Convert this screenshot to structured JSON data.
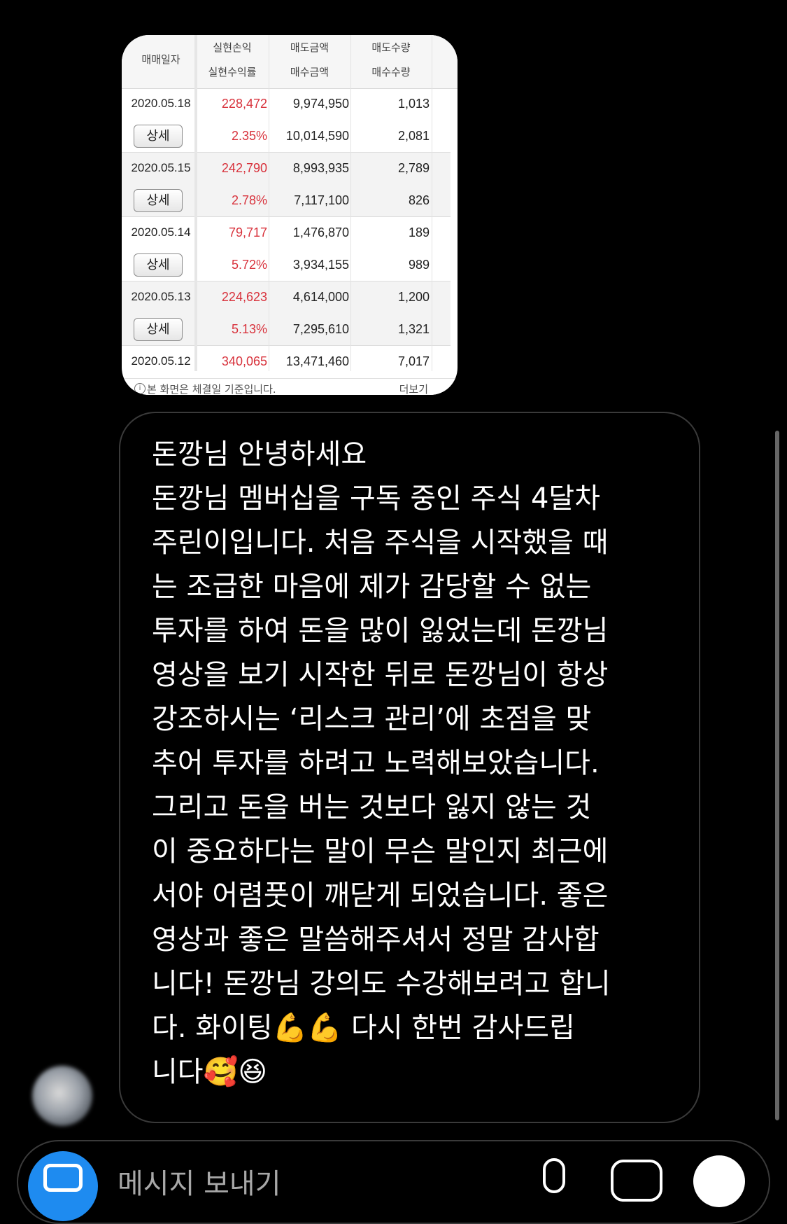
{
  "shared_image": {
    "headers": {
      "date": "매매일자",
      "col2_top": "실현손익",
      "col2_bottom": "실현수익률",
      "col3_top": "매도금액",
      "col3_bottom": "매수금액",
      "col4_top": "매도수량",
      "col4_bottom": "매수수량"
    },
    "detail_label": "상세",
    "rows": [
      {
        "date": "2020.05.18",
        "profit": "228,472",
        "rate": "2.35%",
        "sell_amount": "9,974,950",
        "buy_amount": "10,014,590",
        "sell_qty": "1,013",
        "buy_qty": "2,081"
      },
      {
        "date": "2020.05.15",
        "profit": "242,790",
        "rate": "2.78%",
        "sell_amount": "8,993,935",
        "buy_amount": "7,117,100",
        "sell_qty": "2,789",
        "buy_qty": "826"
      },
      {
        "date": "2020.05.14",
        "profit": "79,717",
        "rate": "5.72%",
        "sell_amount": "1,476,870",
        "buy_amount": "3,934,155",
        "sell_qty": "189",
        "buy_qty": "989"
      },
      {
        "date": "2020.05.13",
        "profit": "224,623",
        "rate": "5.13%",
        "sell_amount": "4,614,000",
        "buy_amount": "7,295,610",
        "sell_qty": "1,200",
        "buy_qty": "1,321"
      },
      {
        "date": "2020.05.12",
        "profit": "340,065",
        "sell_amount": "13,471,460",
        "sell_qty": "7,017"
      }
    ],
    "footer_note": "본 화면은 체결일 기준입니다.",
    "footer_more": "더보기"
  },
  "message": {
    "text": "돈깡님 안녕하세요\n돈깡님 멤버십을 구독 중인 주식 4달차\n주린이입니다. 처음 주식을 시작했을 때\n는 조급한 마음에 제가 감당할 수 없는\n투자를 하여 돈을 많이 잃었는데 돈깡님\n영상을 보기 시작한 뒤로 돈깡님이 항상\n강조하시는 ‘리스크 관리’에 초점을 맞\n추어 투자를 하려고 노력해보았습니다.\n그리고 돈을 버는 것보다 잃지 않는 것\n이 중요하다는 말이 무슨 말인지 최근에\n서야 어렴풋이 깨닫게 되었습니다. 좋은\n영상과 좋은 말씀해주셔서 정말 감사합\n니다! 돈깡님 강의도 수강해보려고 합니\n다. 화이팅💪💪 다시 한번 감사드립\n니다🥰😆"
  },
  "composer": {
    "placeholder": "메시지 보내기"
  },
  "icons": {
    "camera": "camera-icon",
    "mic": "microphone-icon",
    "gallery": "gallery-icon",
    "plus": "plus-icon"
  },
  "colors": {
    "accent_blue": "#1e8bf0",
    "profit_red": "#d8323c"
  }
}
